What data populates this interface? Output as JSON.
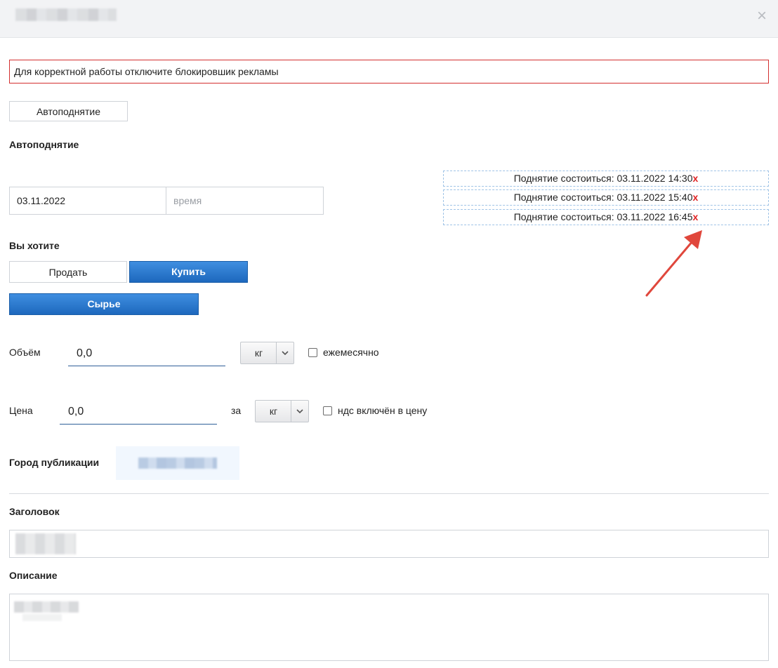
{
  "header": {
    "close_icon": "close-icon"
  },
  "notice": {
    "text": "Для корректной работы отключите блокировшик рекламы",
    "border_color": "#d32f2f"
  },
  "autoraise": {
    "tab_label": "Автоподнятие",
    "section_title": "Автоподнятие",
    "date_value": "03.11.2022",
    "time_placeholder": "время",
    "scheduled": [
      {
        "text": "Поднятие состоиться: 03.11.2022 14:30",
        "remove": "x"
      },
      {
        "text": "Поднятие состоиться: 03.11.2022 15:40",
        "remove": "x"
      },
      {
        "text": "Поднятие состоиться: 03.11.2022 16:45",
        "remove": "x"
      }
    ],
    "remove_color": "#e02424"
  },
  "intent": {
    "title": "Вы хотите",
    "sell_label": "Продать",
    "buy_label": "Купить",
    "category_label": "Сырье",
    "accent_color": "#1d68bd"
  },
  "volume": {
    "label": "Объём",
    "value": "0,0",
    "unit": "кг",
    "monthly_label": "ежемесячно"
  },
  "price": {
    "label": "Цена",
    "value": "0,0",
    "per_label": "за",
    "unit": "кг",
    "vat_label": "ндс включён в цену"
  },
  "city": {
    "label": "Город публикации"
  },
  "title_field": {
    "label": "Заголовок"
  },
  "description_field": {
    "label": "Описание"
  },
  "annotation": {
    "arrow_color": "#e0473c"
  }
}
